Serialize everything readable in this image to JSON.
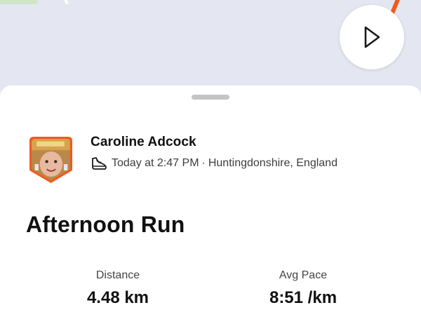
{
  "athlete": {
    "name": "Caroline Adcock",
    "timestamp": "Today at 2:47 PM",
    "separator": "·",
    "location": "Huntingdonshire, England",
    "sport_icon": "running-shoe-icon"
  },
  "activity": {
    "title": "Afternoon Run"
  },
  "stats": [
    {
      "label": "Distance",
      "value": "4.48 km"
    },
    {
      "label": "Avg Pace",
      "value": "8:51 /km"
    }
  ],
  "map": {
    "route_color": "#f05a1e",
    "play_icon": "play-icon"
  },
  "colors": {
    "accent": "#f05a1e",
    "sheet_bg": "#ffffff",
    "map_bg": "#e4e7f1"
  }
}
